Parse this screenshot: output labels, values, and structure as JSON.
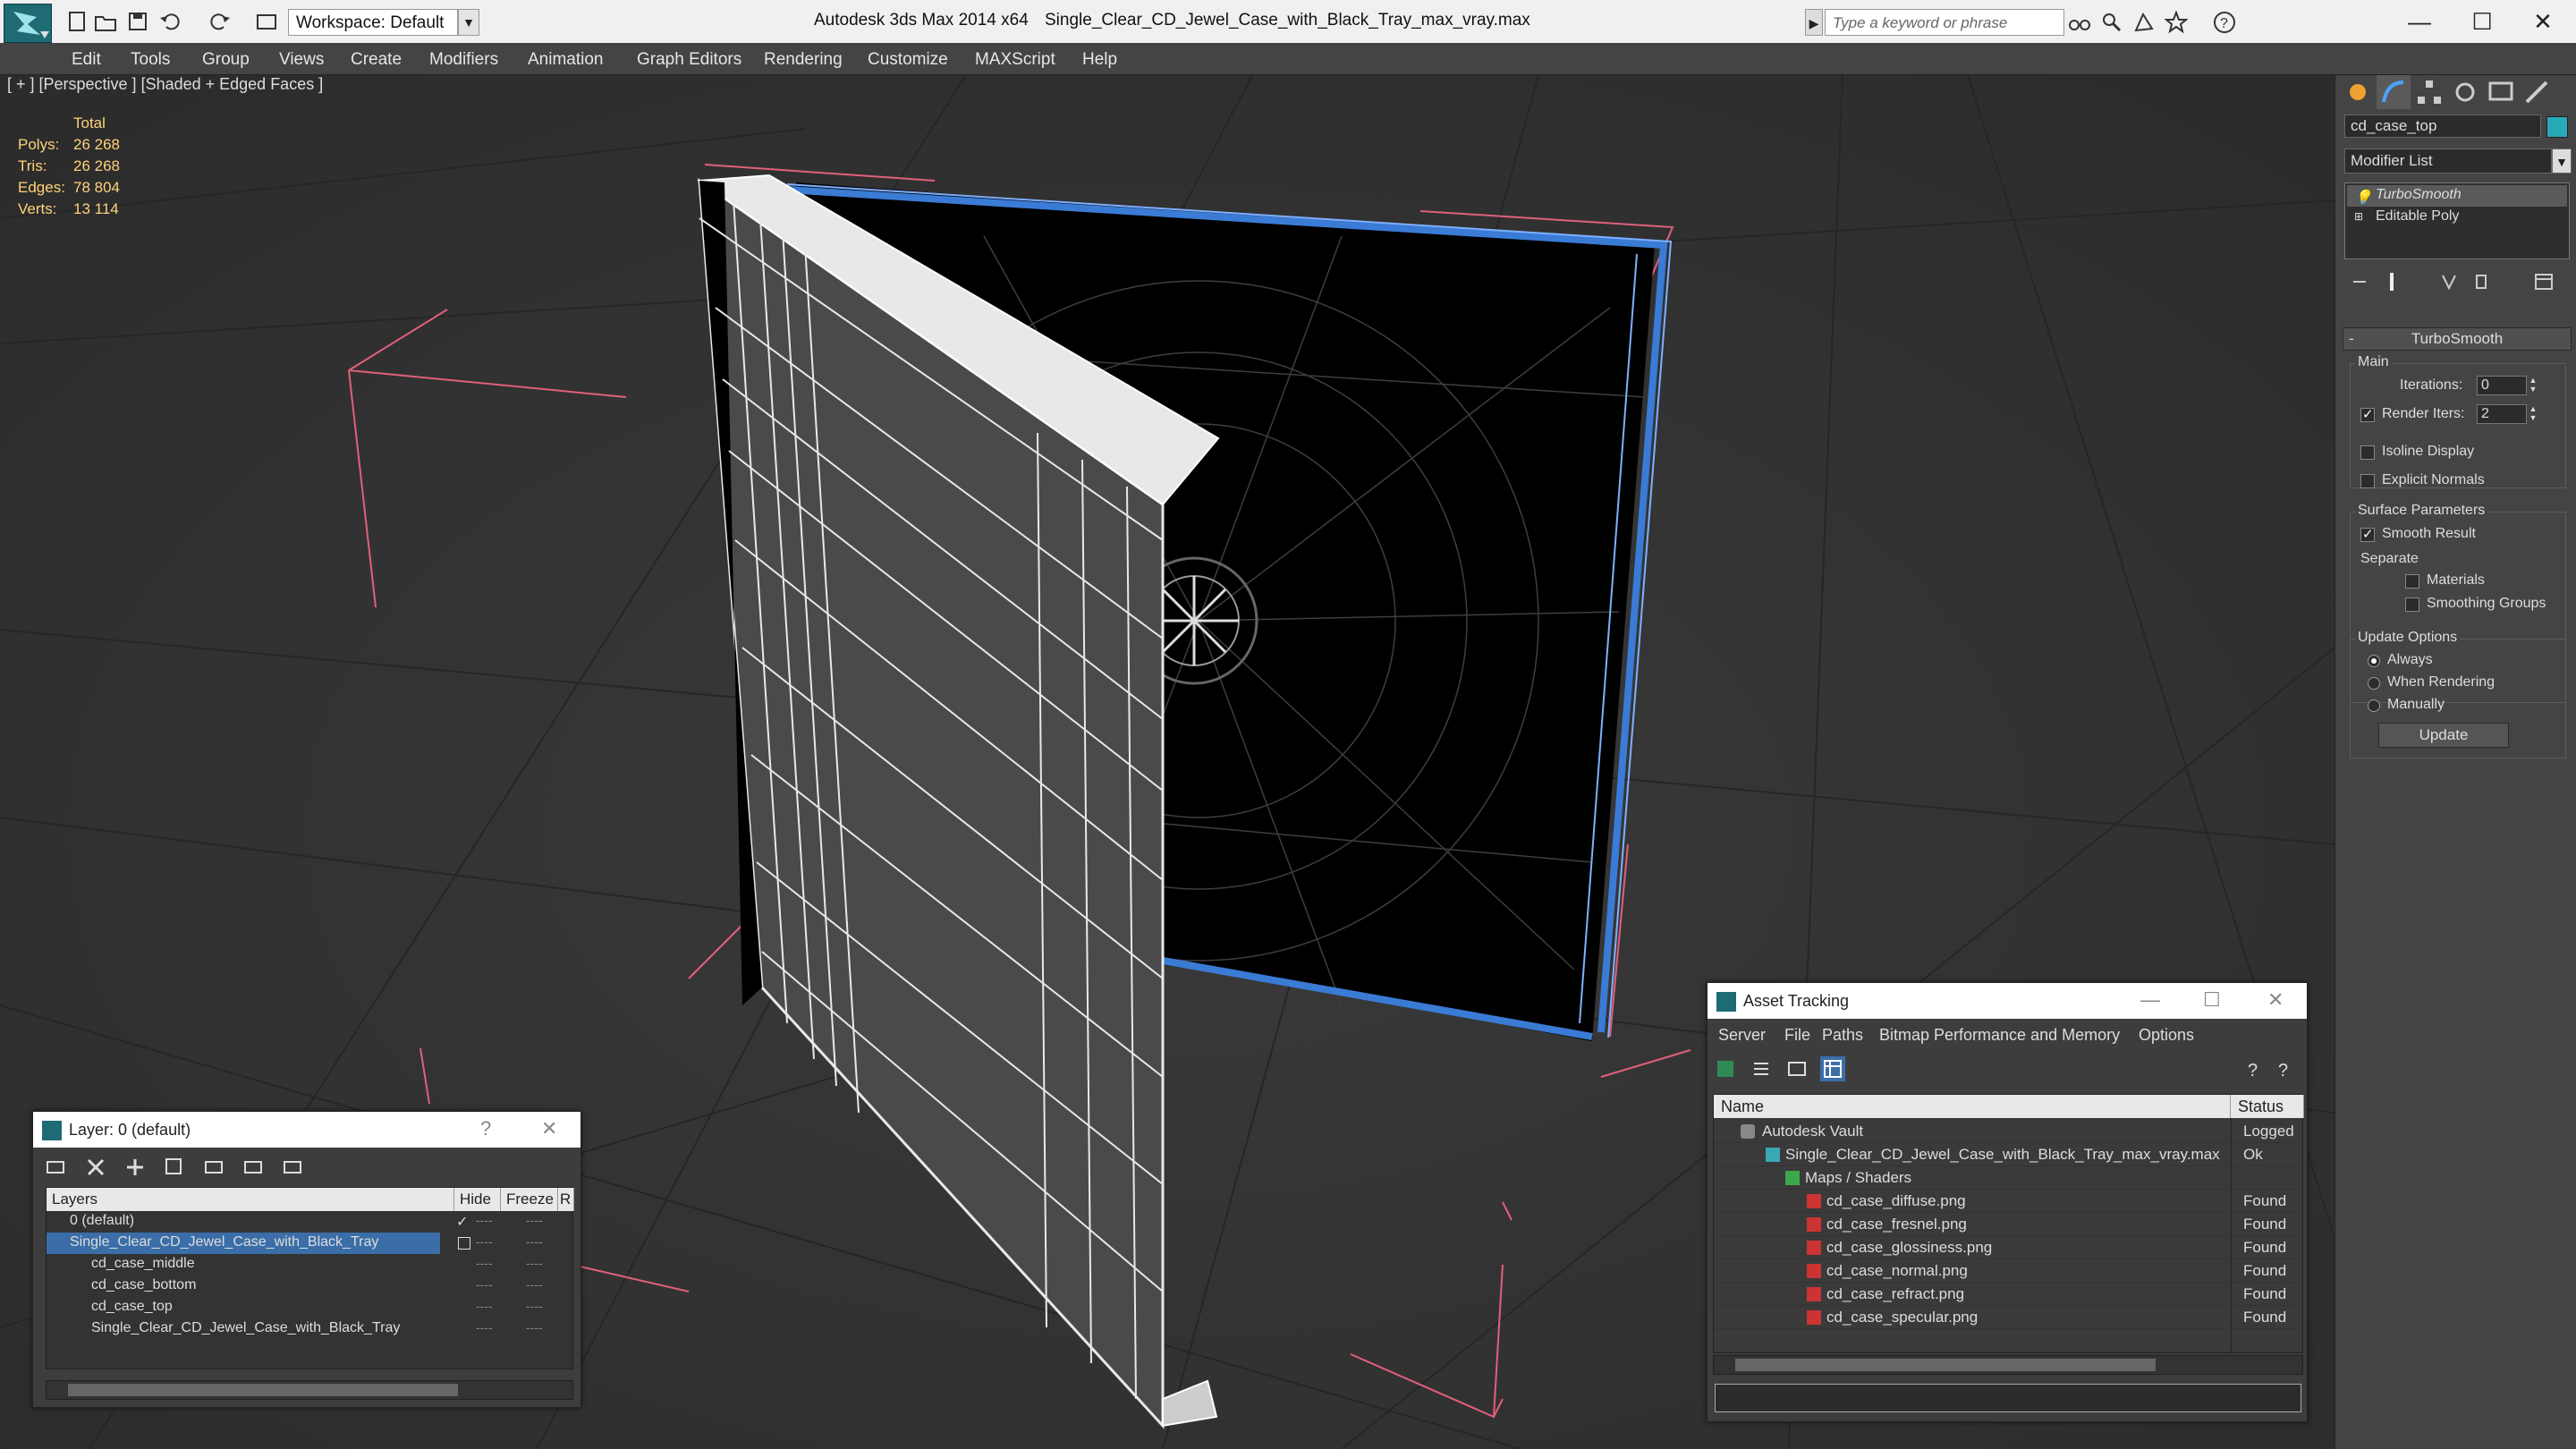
{
  "titlebar": {
    "workspace_label": "Workspace: Default",
    "app_title": "Autodesk 3ds Max 2014 x64",
    "file_title": "Single_Clear_CD_Jewel_Case_with_Black_Tray_max_vray.max",
    "search_placeholder": "Type a keyword or phrase",
    "minimize": "—",
    "maximize": "☐",
    "close": "✕"
  },
  "menu": [
    "Edit",
    "Tools",
    "Group",
    "Views",
    "Create",
    "Modifiers",
    "Animation",
    "Graph Editors",
    "Rendering",
    "Customize",
    "MAXScript",
    "Help"
  ],
  "viewport": {
    "label": "[ + ] [Perspective ] [Shaded + Edged Faces ]",
    "stats": {
      "total_label": "Total",
      "rows": [
        {
          "label": "Polys:",
          "value": "26 268"
        },
        {
          "label": "Tris:",
          "value": "26 268"
        },
        {
          "label": "Edges:",
          "value": "78 804"
        },
        {
          "label": "Verts:",
          "value": "13 114"
        }
      ]
    }
  },
  "command_panel": {
    "object_name": "cd_case_top",
    "object_color": "#29a9b7",
    "modifier_list": "Modifier List",
    "stack": [
      "TurboSmooth",
      "Editable Poly"
    ],
    "turbosmooth": {
      "title": "TurboSmooth",
      "main_label": "Main",
      "iterations_label": "Iterations:",
      "iterations_value": "0",
      "render_iters_label": "Render Iters:",
      "render_iters_value": "2",
      "isoline_label": "Isoline Display",
      "explicit_normals_label": "Explicit Normals",
      "surface_label": "Surface Parameters",
      "smooth_result_label": "Smooth Result",
      "separate_label": "Separate",
      "materials_label": "Materials",
      "smoothing_groups_label": "Smoothing Groups",
      "update_options_label": "Update Options",
      "always_label": "Always",
      "when_rendering_label": "When Rendering",
      "manually_label": "Manually",
      "update_button": "Update"
    }
  },
  "layer_dialog": {
    "title": "Layer: 0 (default)",
    "help": "?",
    "close": "✕",
    "headers": {
      "layers": "Layers",
      "hide": "Hide",
      "freeze": "Freeze",
      "render": "R"
    },
    "rows": [
      {
        "name": "0 (default)",
        "dash1": "----",
        "dash2": "----"
      },
      {
        "name": "Single_Clear_CD_Jewel_Case_with_Black_Tray",
        "dash1": "----",
        "dash2": "----"
      },
      {
        "name": "cd_case_middle",
        "dash1": "----",
        "dash2": "----"
      },
      {
        "name": "cd_case_bottom",
        "dash1": "----",
        "dash2": "----"
      },
      {
        "name": "cd_case_top",
        "dash1": "----",
        "dash2": "----"
      },
      {
        "name": "Single_Clear_CD_Jewel_Case_with_Black_Tray",
        "dash1": "----",
        "dash2": "----"
      }
    ]
  },
  "asset_dialog": {
    "title": "Asset Tracking",
    "minimize": "—",
    "maximize": "☐",
    "close": "✕",
    "menu": [
      "Server",
      "File",
      "Paths",
      "Bitmap Performance and Memory",
      "Options"
    ],
    "headers": {
      "name": "Name",
      "status": "Status"
    },
    "rows": [
      {
        "name": "Autodesk Vault",
        "status": "Logged"
      },
      {
        "name": "Single_Clear_CD_Jewel_Case_with_Black_Tray_max_vray.max",
        "status": "Ok"
      },
      {
        "name": "Maps / Shaders",
        "status": ""
      },
      {
        "name": "cd_case_diffuse.png",
        "status": "Found"
      },
      {
        "name": "cd_case_fresnel.png",
        "status": "Found"
      },
      {
        "name": "cd_case_glossiness.png",
        "status": "Found"
      },
      {
        "name": "cd_case_normal.png",
        "status": "Found"
      },
      {
        "name": "cd_case_refract.png",
        "status": "Found"
      },
      {
        "name": "cd_case_specular.png",
        "status": "Found"
      }
    ]
  }
}
